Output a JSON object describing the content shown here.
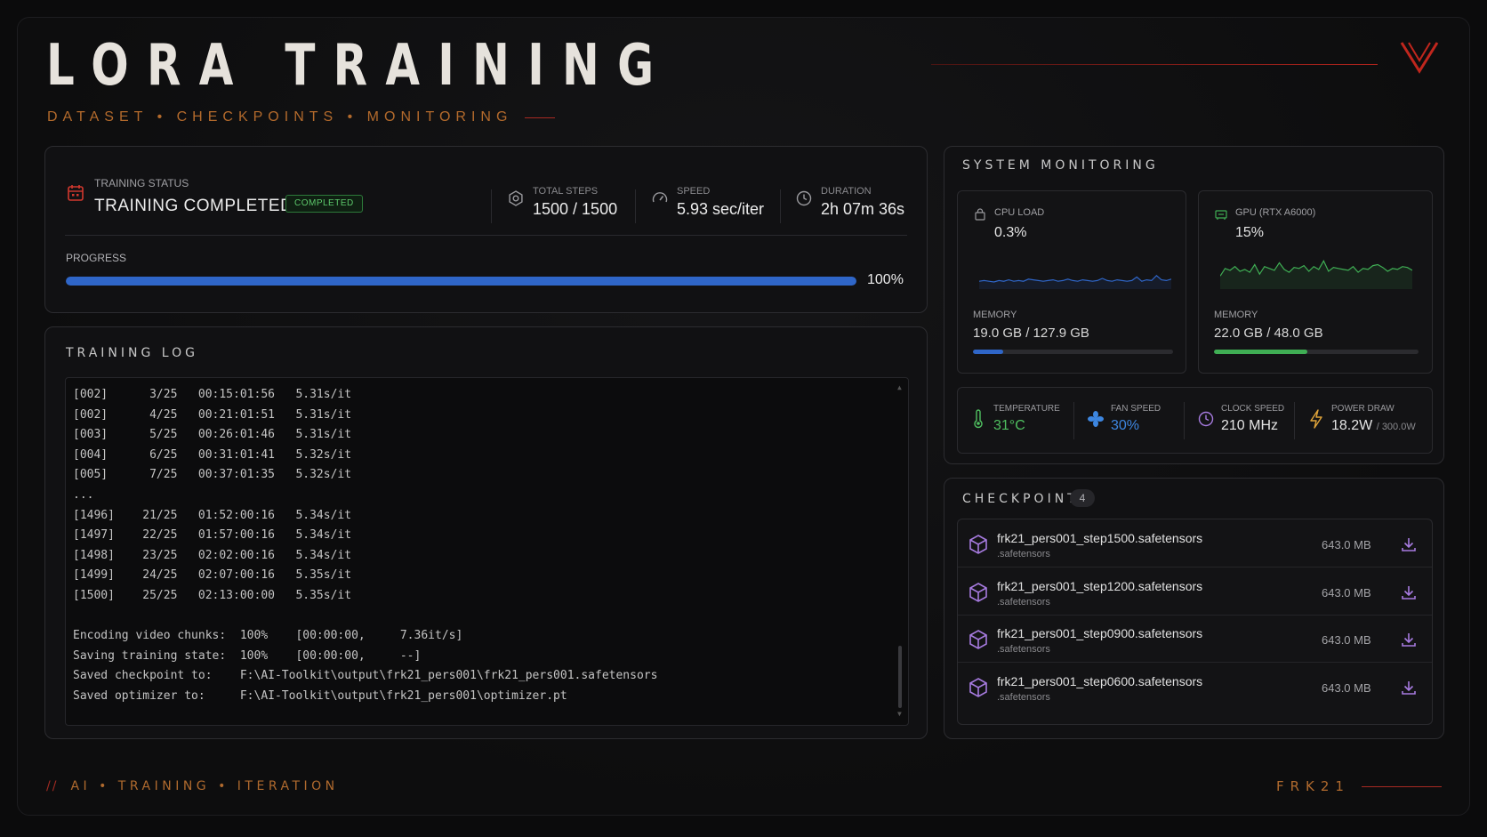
{
  "header": {
    "title": "LORA TRAINING",
    "subtitle": "DATASET • CHECKPOINTS • MONITORING"
  },
  "status": {
    "label": "TRAINING STATUS",
    "value": "TRAINING COMPLETED",
    "badge": "COMPLETED",
    "stats": [
      {
        "icon": "gear-icon",
        "label": "TOTAL STEPS",
        "value": "1500 / 1500"
      },
      {
        "icon": "speedometer-icon",
        "label": "SPEED",
        "value": "5.93 sec/iter"
      },
      {
        "icon": "clock-icon",
        "label": "DURATION",
        "value": "2h 07m 36s"
      }
    ],
    "progress_label": "PROGRESS",
    "progress_fraction": 1.0,
    "progress_text": "100%"
  },
  "log": {
    "title": "TRAINING LOG",
    "lines": [
      "[002]      3/25   00:15:01:56   5.31s/it",
      "[002]      4/25   00:21:01:51   5.31s/it",
      "[003]      5/25   00:26:01:46   5.31s/it",
      "[004]      6/25   00:31:01:41   5.32s/it",
      "[005]      7/25   00:37:01:35   5.32s/it",
      "...",
      "[1496]    21/25   01:52:00:16   5.34s/it",
      "[1497]    22/25   01:57:00:16   5.34s/it",
      "[1498]    23/25   02:02:00:16   5.34s/it",
      "[1499]    24/25   02:07:00:16   5.35s/it",
      "[1500]    25/25   02:13:00:00   5.35s/it",
      "",
      "Encoding video chunks:  100%    [00:00:00,     7.36it/s]",
      "Saving training state:  100%    [00:00:00,     --]",
      "Saved checkpoint to:    F:\\AI-Toolkit\\output\\frk21_pers001\\frk21_pers001.safetensors",
      "Saved optimizer to:     F:\\AI-Toolkit\\output\\frk21_pers001\\optimizer.pt"
    ]
  },
  "system": {
    "title": "SYSTEM MONITORING",
    "cpu": {
      "label": "CPU LOAD",
      "value": "0.3%",
      "memory_label": "MEMORY",
      "memory_value": "19.0 GB / 127.9 GB",
      "memory_fraction": 0.149,
      "color": "#2f66c8",
      "spark": [
        6,
        7,
        6,
        5,
        7,
        6,
        8,
        6,
        7,
        6,
        9,
        8,
        7,
        6,
        7,
        8,
        6,
        7,
        9,
        7,
        6,
        8,
        7,
        6,
        7,
        10,
        7,
        6,
        8,
        7,
        6,
        7,
        12,
        6,
        8,
        7,
        14,
        8,
        7,
        9
      ]
    },
    "gpu": {
      "label": "GPU (RTX A6000)",
      "value": "15%",
      "memory_label": "MEMORY",
      "memory_value": "22.0 GB / 48.0 GB",
      "memory_fraction": 0.458,
      "color": "#3fae54",
      "spark": [
        10,
        18,
        16,
        20,
        15,
        17,
        14,
        22,
        12,
        20,
        18,
        16,
        24,
        17,
        14,
        19,
        18,
        21,
        15,
        20,
        17,
        26,
        15,
        19,
        18,
        17,
        16,
        20,
        14,
        18,
        17,
        21,
        22,
        19,
        15,
        18,
        17,
        20,
        19,
        16
      ]
    },
    "metrics": [
      {
        "icon": "thermometer-icon",
        "label": "TEMPERATURE",
        "value": "31°C",
        "color": "#4fbf60"
      },
      {
        "icon": "fan-icon",
        "label": "FAN SPEED",
        "value": "30%",
        "color": "#3d86e0"
      },
      {
        "icon": "clock-speed-icon",
        "label": "CLOCK SPEED",
        "value": "210 MHz",
        "color": "#e4e4e4"
      },
      {
        "icon": "lightning-icon",
        "label": "POWER DRAW",
        "value": "18.2W",
        "sub": "/ 300.0W",
        "color": "#e4e4e4"
      }
    ]
  },
  "checkpoints": {
    "title": "CHECKPOINTS",
    "count": "4",
    "items": [
      {
        "name": "frk21_pers001_step1500.safetensors",
        "ext": ".safetensors",
        "size": "643.0 MB"
      },
      {
        "name": "frk21_pers001_step1200.safetensors",
        "ext": ".safetensors",
        "size": "643.0 MB"
      },
      {
        "name": "frk21_pers001_step0900.safetensors",
        "ext": ".safetensors",
        "size": "643.0 MB"
      },
      {
        "name": "frk21_pers001_step0600.safetensors",
        "ext": ".safetensors",
        "size": "643.0 MB"
      }
    ]
  },
  "footer": {
    "slashes": "//",
    "left": "AI • TRAINING • ITERATION",
    "right": "FRK21"
  },
  "colors": {
    "accent_red": "#b0231c",
    "accent_orange": "#b36a2c",
    "progress_blue": "#2f66c8",
    "success_green": "#5dc86b",
    "checkpoint_purple": "#a77be0"
  }
}
